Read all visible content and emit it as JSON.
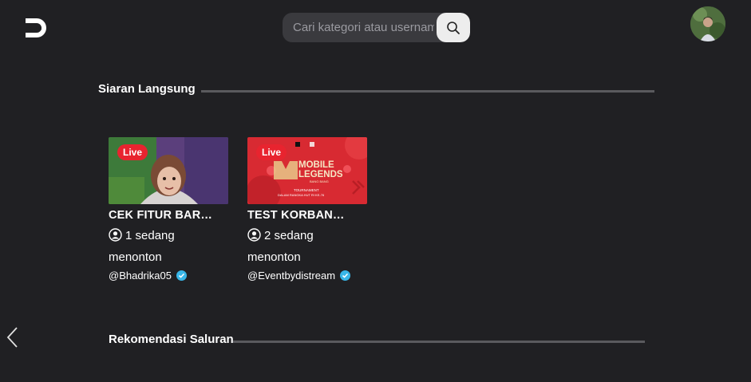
{
  "header": {
    "logo_text": "STREAM",
    "search_placeholder": "Cari kategori atau username"
  },
  "sections": {
    "live_title": "Siaran Langsung",
    "recommend_title": "Rekomendasi Saluran"
  },
  "streams": [
    {
      "badge": "Live",
      "title": "CEK FITUR BARU…",
      "viewers": "1 sedang menonton",
      "handle": "@Bhadrika05"
    },
    {
      "badge": "Live",
      "title": "TEST KORBAN…",
      "viewers": "2 sedang menonton",
      "handle": "@Eventbydistream",
      "thumb_text_1": "MOBILE",
      "thumb_text_2": "LEGENDS",
      "thumb_text_3": "BANG BANG",
      "thumb_text_4": "TOURNAMENT",
      "thumb_text_5": "DALAM RANGKA HUT RI KE-76"
    }
  ],
  "colors": {
    "background": "#202023",
    "live_red": "#e8242f",
    "verified_blue": "#38b6e8"
  }
}
